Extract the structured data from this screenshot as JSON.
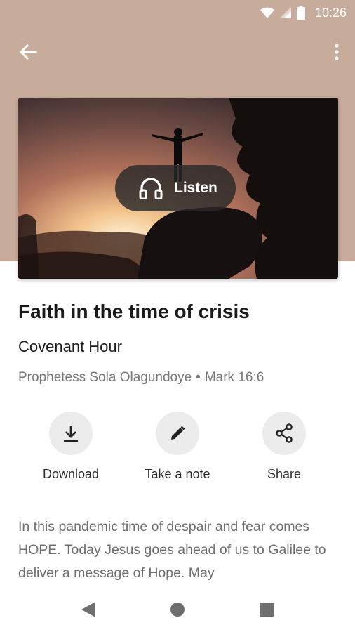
{
  "status_bar": {
    "time": "10:26"
  },
  "app_bar": {
    "back_icon": "arrow-back-icon",
    "more_icon": "more-vert-icon"
  },
  "hero": {
    "listen_label": "Listen",
    "listen_icon": "headphones-icon"
  },
  "sermon": {
    "title": "Faith in the time of crisis",
    "series": "Covenant Hour",
    "speaker": "Prophetess Sola Olagundoye",
    "separator": "•",
    "scripture": "Mark 16:6",
    "description": "In this pandemic time of despair and fear comes HOPE. Today Jesus goes ahead of us to Galilee to deliver a message of Hope. May"
  },
  "actions": [
    {
      "label": "Download",
      "icon": "download-icon"
    },
    {
      "label": "Take a note",
      "icon": "pencil-icon"
    },
    {
      "label": "Share",
      "icon": "share-icon"
    }
  ],
  "colors": {
    "header_bg": "#c8ac9b",
    "action_bg": "#ebebeb",
    "listen_bg": "#282828"
  }
}
